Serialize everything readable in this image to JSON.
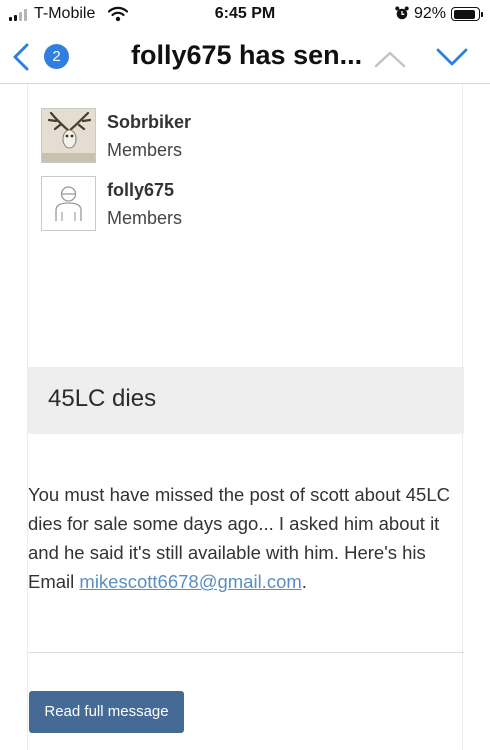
{
  "status_bar": {
    "carrier": "T-Mobile",
    "time": "6:45 PM",
    "battery_percent": "92%",
    "battery_level": 0.92,
    "icons": [
      "signal-icon",
      "wifi-icon",
      "alarm-icon",
      "battery-icon"
    ]
  },
  "nav": {
    "badge_count": "2",
    "title": "folly675 has sen...",
    "icons": [
      "back-chevron-icon",
      "up-chevron-icon",
      "down-chevron-icon"
    ],
    "accent_color": "#2f7fe0"
  },
  "members": [
    {
      "name": "Sobrbiker",
      "role": "Members"
    },
    {
      "name": "folly675",
      "role": "Members"
    }
  ],
  "message": {
    "subject": "45LC dies",
    "body_text": "You must have missed the post of scott about 45LC dies for sale some days ago... I asked him about it and he said it's still available with him. Here's his Email ",
    "email": "mikescott6678@gmail.com",
    "body_suffix": ".",
    "read_button_label": "Read full message",
    "button_color": "#446a95"
  }
}
